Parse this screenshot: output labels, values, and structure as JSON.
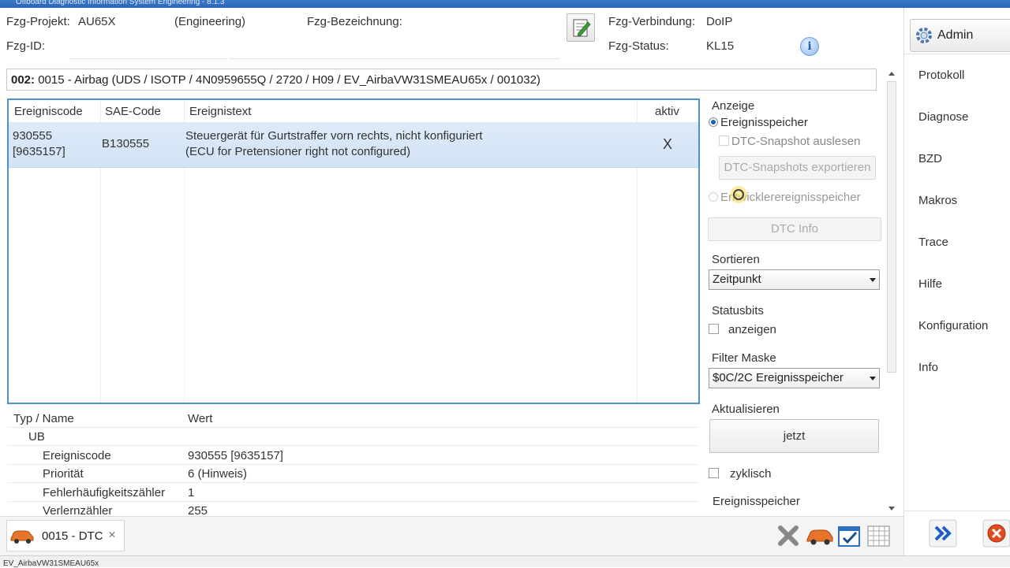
{
  "window": {
    "title": "Offboard Diagnostic Information System Engineering - 8.1.3"
  },
  "header": {
    "project_label": "Fzg-Projekt:",
    "project_value": "AU65X",
    "project_mode": "(Engineering)",
    "designation_label": "Fzg-Bezeichnung:",
    "id_label": "Fzg-ID:",
    "connection_label": "Fzg-Verbindung:",
    "connection_value": "DoIP",
    "status_label": "Fzg-Status:",
    "status_value": "KL15",
    "info_icon": "i"
  },
  "path": {
    "prefix": "002:",
    "text": " 0015 - Airbag  (UDS / ISOTP / 4N0959655Q / 2720 / H09 / EV_AirbaVW31SMEAU65x / 001032)"
  },
  "dtc_table": {
    "columns": [
      "Ereigniscode",
      "SAE-Code",
      "Ereignistext",
      "aktiv"
    ],
    "rows": [
      {
        "code_line1": "930555",
        "code_line2": "[9635157]",
        "sae": "B130555",
        "text_line1": "Steuergerät für Gurtstraffer vorn rechts, nicht konfiguriert",
        "text_line2": "(ECU for Pretensioner right not configured)",
        "active": "X"
      }
    ]
  },
  "details": {
    "columns": [
      "Typ / Name",
      "Wert"
    ],
    "rows": [
      {
        "name": "UB",
        "value": ""
      },
      {
        "name": "Ereigniscode",
        "value": "930555 [9635157]"
      },
      {
        "name": "Priorität",
        "value": "6 (Hinweis)"
      },
      {
        "name": "Fehlerhäufigkeitszähler",
        "value": "1"
      },
      {
        "name": "Verlernzähler",
        "value": "255"
      }
    ]
  },
  "panel": {
    "anzeige_label": "Anzeige",
    "radio_ereignisspeicher": "Ereignisspeicher",
    "chk_snapshot": "DTC-Snapshot auslesen",
    "btn_export": "DTC-Snapshots exportieren",
    "radio_entwickler": "Entwicklerereignisspeicher",
    "btn_dtc_info": "DTC Info",
    "sort_label": "Sortieren",
    "sort_value": "Zeitpunkt",
    "statusbits_label": "Statusbits",
    "chk_anzeigen": "anzeigen",
    "filter_label": "Filter Maske",
    "filter_value": "$0C/2C Ereignisspeicher",
    "update_label": "Aktualisieren",
    "btn_jetzt": "jetzt",
    "chk_zyklisch": "zyklisch",
    "ereignisspeicher_label": "Ereignisspeicher"
  },
  "bottom": {
    "tab_label": "0015 - DTC",
    "tab_close": "✕"
  },
  "statusbar": {
    "text": "EV_AirbaVW31SMEAU65x"
  },
  "sidebar": {
    "admin_label": "Admin",
    "items": [
      "Protokoll",
      "Diagnose",
      "BZD",
      "Makros",
      "Trace",
      "Hilfe",
      "Konfiguration",
      "Info"
    ]
  },
  "colors": {
    "selection": "#d6e6f7",
    "table_border": "#4f8fd6",
    "radio_accent": "#1c5fb4"
  }
}
